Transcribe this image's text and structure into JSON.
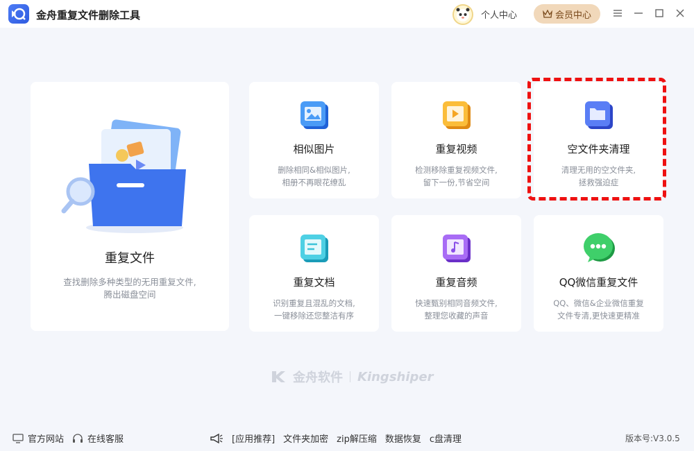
{
  "app": {
    "title": "金舟重复文件删除工具"
  },
  "header": {
    "user_center": "个人中心",
    "vip": "会员中心"
  },
  "main_card": {
    "title": "重复文件",
    "desc_line1": "查找删除多种类型的无用重复文件,",
    "desc_line2": "腾出磁盘空间"
  },
  "cards": [
    {
      "title": "相似图片",
      "desc_line1": "删除相同&相似图片,",
      "desc_line2": "相册不再眼花缭乱",
      "icon": "image-icon",
      "color": "#3d8cf0"
    },
    {
      "title": "重复视频",
      "desc_line1": "检测移除重复视频文件,",
      "desc_line2": "留下一份,节省空间",
      "icon": "video-icon",
      "color": "#f5a623"
    },
    {
      "title": "空文件夹清理",
      "desc_line1": "清理无用的空文件夹,",
      "desc_line2": "拯救强迫症",
      "icon": "folder-icon",
      "color": "#4b6ef0"
    },
    {
      "title": "重复文档",
      "desc_line1": "识别重复且混乱的文档,",
      "desc_line2": "一键移除还您整洁有序",
      "icon": "document-icon",
      "color": "#3cc3d8"
    },
    {
      "title": "重复音频",
      "desc_line1": "快速甄别相同音频文件,",
      "desc_line2": "整理您收藏的声音",
      "icon": "music-icon",
      "color": "#9b5cf0"
    },
    {
      "title": "QQ微信重复文件",
      "desc_line1": "QQ、微信&企业微信重复",
      "desc_line2": "文件专清,更快速更精准",
      "icon": "chat-icon",
      "color": "#2ec05a"
    }
  ],
  "brand": {
    "cn": "金舟软件",
    "en": "Kingshiper"
  },
  "footer": {
    "official_site": "官方网站",
    "online_service": "在线客服",
    "links": [
      "[应用推荐]",
      "文件夹加密",
      "zip解压缩",
      "数据恢复",
      "c盘清理"
    ],
    "version": "版本号:V3.0.5"
  }
}
